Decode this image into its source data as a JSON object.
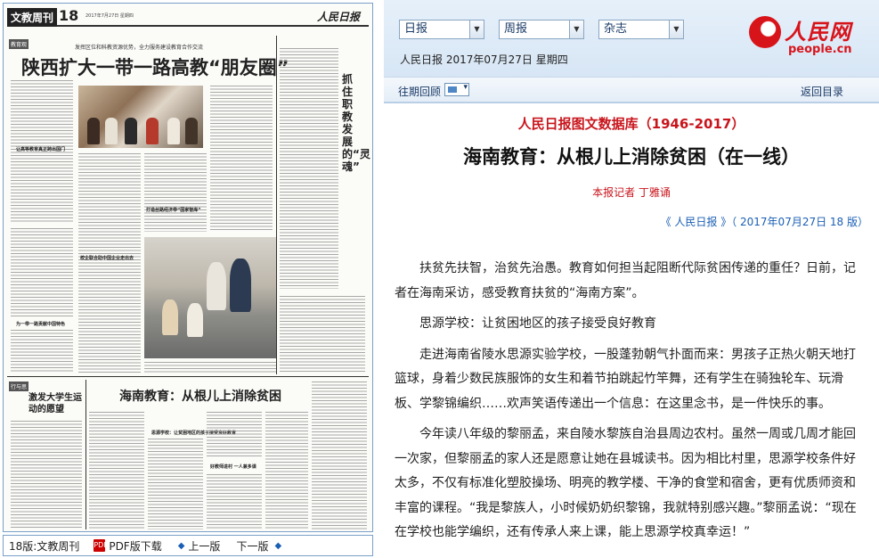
{
  "newspaper": {
    "section_label": "文教周刊",
    "page_number": "18",
    "page_date": "2017年7月27日 星期四",
    "masthead": "人民日报",
    "kicker_1": "教育观",
    "subheadline": "发挥区位和科教资源优势，全力服务建设教育合作交流",
    "headline_1": "陕西扩大一带一路高教“朋友圈”",
    "side_title": "抓住职教发展的“灵魂”",
    "subhead_a": "让高等教育真正跨出国门",
    "subhead_b": "打造丝路经济带“国家智库”",
    "subhead_c": "校企联合助中国企业走出去",
    "subhead_d": "为一带一路贡献中国特色",
    "kicker_2": "行与思",
    "column_title": "激发大学生运动的愿望",
    "headline_2": "海南教育：从根儿上消除贫困",
    "subhead_e": "思源学校：让贫困地区的孩子接受良好教育",
    "subhead_f": "好教师进村 一人兼多课"
  },
  "bottom_bar": {
    "page_label": "18版:文教周刊",
    "pdf_label": "PDF版下载",
    "prev_label": "上一版",
    "next_label": "下一版"
  },
  "header": {
    "select_1": "日报",
    "select_2": "周报",
    "select_3": "杂志",
    "dateline": "人民日报 2017年07月27日 星期四",
    "logo_cn": "人民网",
    "logo_en": "people.cn",
    "archive_label": "往期回顾",
    "back_label": "返回目录"
  },
  "article": {
    "database_title": "人民日报图文数据库（1946-2017）",
    "title": "海南教育：从根儿上消除贫困（在一线）",
    "author": "本报记者  丁雅诵",
    "source": "《 人民日报 》（ 2017年07月27日   18 版）",
    "paragraphs": [
      "扶贫先扶智，治贫先治愚。教育如何担当起阻断代际贫困传递的重任？日前，记者在海南采访，感受教育扶贫的“海南方案”。",
      "思源学校：让贫困地区的孩子接受良好教育",
      "走进海南省陵水思源实验学校，一股蓬勃朝气扑面而来：男孩子正热火朝天地打篮球，身着少数民族服饰的女生和着节拍跳起竹竿舞，还有学生在骑独轮车、玩滑板、学黎锦编织……欢声笑语传递出一个信息：在这里念书，是一件快乐的事。",
      "今年读八年级的黎丽孟，来自陵水黎族自治县周边农村。虽然一周或几周才能回一次家，但黎丽孟的家人还是愿意让她在县城读书。因为相比村里，思源学校条件好太多，不仅有标准化塑胶操场、明亮的教学楼、干净的食堂和宿舍，更有优质师资和丰富的课程。“我是黎族人，小时候奶奶织黎锦，我就特别感兴趣。”黎丽孟说：“现在在学校也能学编织，还有传承人来上课，能上思源学校真幸运！”"
    ]
  },
  "colors": {
    "accent_red": "#c8151c",
    "link_blue": "#1a5fb4",
    "header_bg": "#e2edf8"
  }
}
